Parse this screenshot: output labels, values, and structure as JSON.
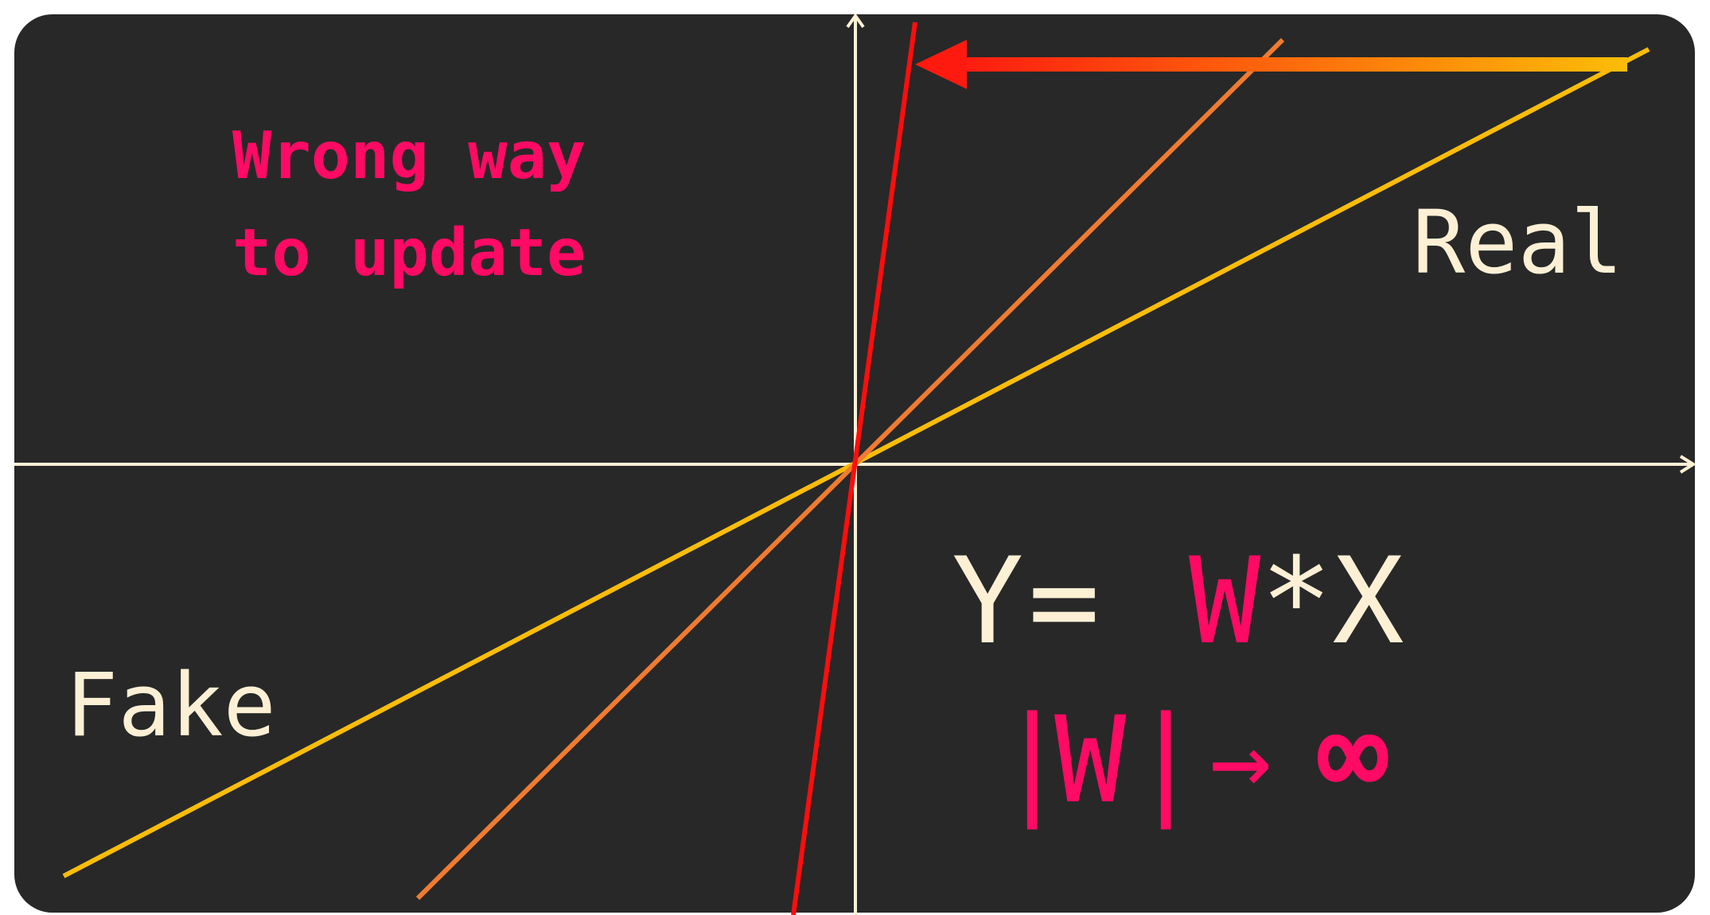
{
  "diagram": {
    "caption_line1": "Wrong way",
    "caption_line2": "to update",
    "label_real": "Real",
    "label_fake": "Fake",
    "equation": {
      "y": "Y",
      "eq": "=",
      "w": "W",
      "star_x": "*X"
    },
    "limit": {
      "bar_left": "|",
      "w": "W",
      "bar_right": "|",
      "arrow": "→",
      "infinity": "∞"
    }
  },
  "colors": {
    "background": "#282828",
    "axis": "#fdf0d5",
    "text_cream": "#fdf0d5",
    "accent_pink": "#ff0a64",
    "line_yellow": "#fbbd08",
    "line_orange": "#f07b30",
    "line_red": "#ff0d0d",
    "arrow_start": "#ff1a10",
    "arrow_end": "#fbbd08"
  }
}
